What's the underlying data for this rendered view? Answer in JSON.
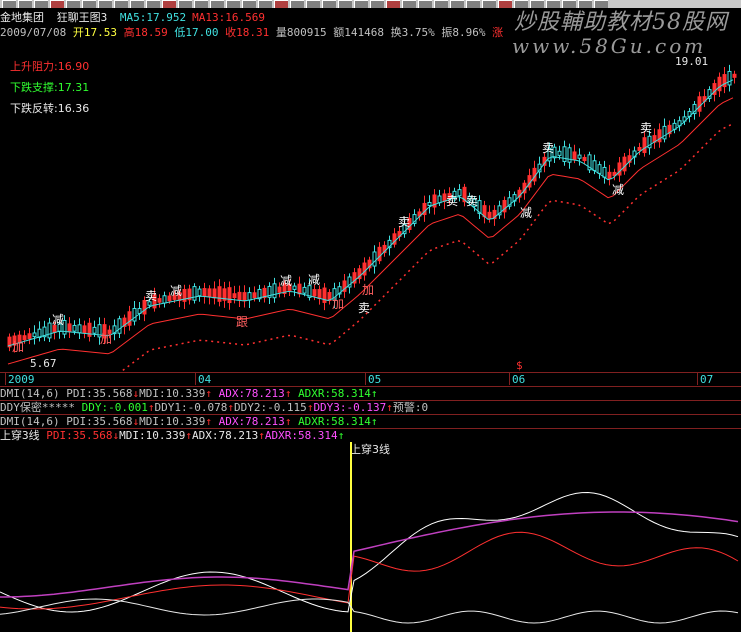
{
  "header": {
    "stock_name": "金地集团",
    "indicator_name": "狂聊王图3",
    "ma5": "MA5:17.952",
    "ma13": "MA13:16.569",
    "date": "2009/07/08",
    "open": "开17.53",
    "high": "高18.59",
    "low": "低17.00",
    "close": "收18.31",
    "volume": "量800915",
    "amount": "额141468",
    "turnover": "换3.75%",
    "amplitude": "振8.96%",
    "change": "涨"
  },
  "watermark": {
    "line1": "炒股輔助教材58股网",
    "line2": "www.58Gu.com"
  },
  "levels": {
    "resistance": "上升阻力:16.90",
    "support": "下跌支撑:17.31",
    "reversal": "下跌反转:16.36"
  },
  "price_labels": {
    "top": "19.01",
    "bottom": "5.67"
  },
  "signals": [
    "减",
    "卖",
    "减",
    "加",
    "跟",
    "减",
    "减",
    "加",
    "卖",
    "加",
    "卖",
    "卖",
    "卖",
    "减",
    "卖",
    "减",
    "卖",
    "加"
  ],
  "x_axis": [
    "2009",
    "04",
    "05",
    "06",
    "07"
  ],
  "x_marker": "$",
  "indicator_rows": {
    "dmi1": {
      "label": "DMI(14,6)",
      "pdi": "PDI:35.568",
      "mdi": "MDI:10.339",
      "adx": "ADX:78.213",
      "adxr": "ADXR:58.314"
    },
    "ddy": {
      "label": "DDY保密*****",
      "ddy": "DDY:-0.001",
      "ddy1": "DDY1:-0.078",
      "ddy2": "DDY2:-0.115",
      "ddy3": "DDY3:-0.137",
      "warn": "预警:0"
    },
    "dmi2": {
      "label": "DMI(14,6)",
      "pdi": "PDI:35.568",
      "mdi": "MDI:10.339",
      "adx": "ADX:78.213",
      "adxr": "ADXR:58.314"
    },
    "sub3": {
      "label": "上穿3线",
      "pdi": "PDI:35.568",
      "mdi": "MDI:10.339",
      "adx": "ADX:78.213",
      "adxr": "ADXR:58.314"
    }
  },
  "cross_label": "上穿3线",
  "colors": {
    "up": "#ff3030",
    "down": "#40e0e0",
    "ma_short": "#40e0e0",
    "ma_long": "#ff3030",
    "cross_line": "#ffff40",
    "pdi": "#ffffff",
    "mdi": "#ff3030",
    "adx": "#ffffff",
    "adxr": "#c040c0"
  }
}
